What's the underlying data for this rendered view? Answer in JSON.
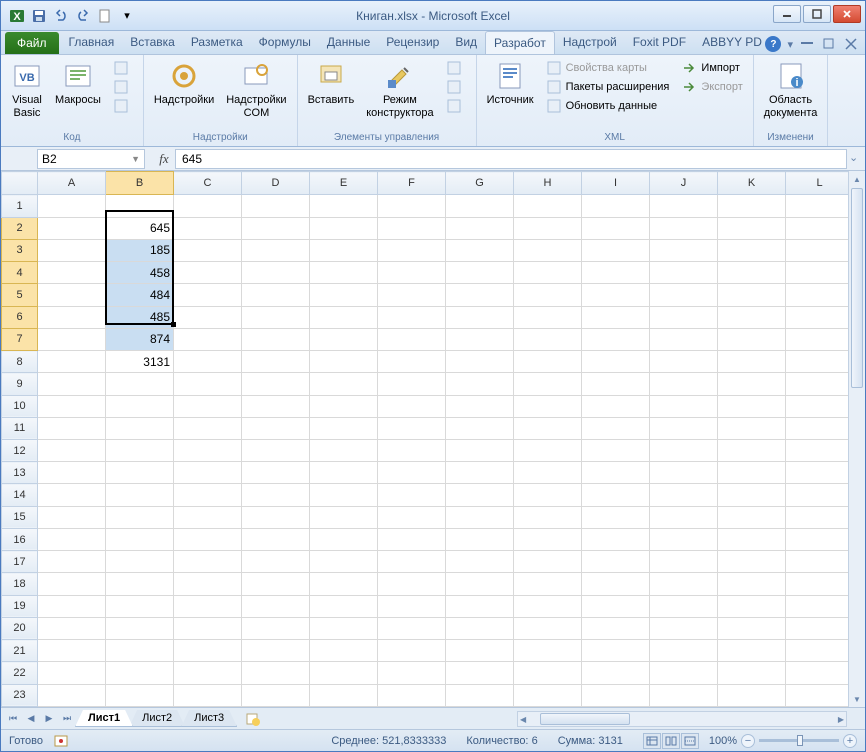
{
  "title": "Книган.xlsx - Microsoft Excel",
  "qat": {
    "save": "save",
    "undo": "undo",
    "redo": "redo",
    "new": "new"
  },
  "tabs": {
    "file": "Файл",
    "items": [
      "Главная",
      "Вставка",
      "Разметка",
      "Формулы",
      "Данные",
      "Рецензир",
      "Вид",
      "Разработ",
      "Надстрой",
      "Foxit PDF",
      "ABBYY PD"
    ],
    "active": 7
  },
  "ribbon": {
    "groups": [
      {
        "name": "code",
        "label": "Код",
        "big": [
          {
            "id": "visual-basic",
            "label": "Visual\nBasic"
          },
          {
            "id": "macros",
            "label": "Макросы"
          }
        ],
        "small": [
          {
            "id": "record",
            "label": ""
          },
          {
            "id": "relative",
            "label": ""
          },
          {
            "id": "security",
            "label": ""
          }
        ]
      },
      {
        "name": "addins",
        "label": "Надстройки",
        "big": [
          {
            "id": "addins",
            "label": "Надстройки"
          },
          {
            "id": "addins-com",
            "label": "Надстройки\nCOM"
          }
        ]
      },
      {
        "name": "controls",
        "label": "Элементы управления",
        "big": [
          {
            "id": "insert",
            "label": "Вставить"
          },
          {
            "id": "design-mode",
            "label": "Режим\nконструктора"
          }
        ],
        "small": [
          {
            "id": "properties",
            "label": ""
          },
          {
            "id": "view-code",
            "label": ""
          },
          {
            "id": "run-dialog",
            "label": ""
          }
        ]
      },
      {
        "name": "xml",
        "label": "XML",
        "big": [
          {
            "id": "source",
            "label": "Источник"
          }
        ],
        "small": [
          {
            "id": "map-props",
            "label": "Свойства карты"
          },
          {
            "id": "expansion",
            "label": "Пакеты расширения"
          },
          {
            "id": "refresh",
            "label": "Обновить данные"
          }
        ],
        "small2": [
          {
            "id": "import",
            "label": "Импорт"
          },
          {
            "id": "export",
            "label": "Экспорт"
          }
        ]
      },
      {
        "name": "modify",
        "label": "Изменени",
        "big": [
          {
            "id": "doc-panel",
            "label": "Область\nдокумента"
          }
        ]
      }
    ]
  },
  "formula_bar": {
    "cell": "B2",
    "fx": "fx",
    "value": "645"
  },
  "grid": {
    "cols": [
      "A",
      "B",
      "C",
      "D",
      "E",
      "F",
      "G",
      "H",
      "I",
      "J",
      "K",
      "L"
    ],
    "rows": 23,
    "selected_col": 1,
    "selected_rows": [
      2,
      3,
      4,
      5,
      6,
      7
    ],
    "active_row": 2,
    "cells": {
      "B2": "645",
      "B3": "185",
      "B4": "458",
      "B5": "484",
      "B6": "485",
      "B7": "874",
      "B8": "3131"
    }
  },
  "sheets": {
    "items": [
      "Лист1",
      "Лист2",
      "Лист3"
    ],
    "active": 0
  },
  "status": {
    "ready": "Готово",
    "avg_label": "Среднее:",
    "avg": "521,8333333",
    "count_label": "Количество:",
    "count": "6",
    "sum_label": "Сумма:",
    "sum": "3131",
    "zoom": "100%"
  }
}
